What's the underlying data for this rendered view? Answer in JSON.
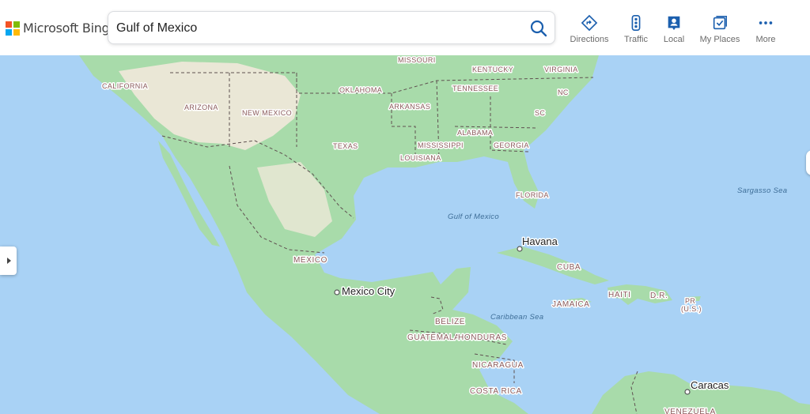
{
  "brand": {
    "name": "Microsoft Bing",
    "logo_colors": [
      "#f35325",
      "#81bc06",
      "#05a6f0",
      "#ffba08"
    ]
  },
  "search": {
    "value": "Gulf of Mexico",
    "icon": "search-icon"
  },
  "nav": [
    {
      "label": "Directions",
      "icon": "directions-icon"
    },
    {
      "label": "Traffic",
      "icon": "traffic-icon"
    },
    {
      "label": "Local",
      "icon": "local-icon"
    },
    {
      "label": "My Places",
      "icon": "my-places-icon"
    },
    {
      "label": "More",
      "icon": "more-icon"
    }
  ],
  "map": {
    "colors": {
      "water": "#a9d2f5",
      "land": "#a8dbaa",
      "desert": "#ede8d8",
      "border": "#5f5050"
    },
    "states": [
      "MISSOURI",
      "KENTUCKY",
      "VIRGINIA",
      "CALIFORNIA",
      "OKLAHOMA",
      "TENNESSEE",
      "NC",
      "ARIZONA",
      "ARKANSAS",
      "NEW MEXICO",
      "SC",
      "ALABAMA",
      "TEXAS",
      "MISSISSIPPI",
      "GEORGIA",
      "LOUISIANA",
      "FLORIDA"
    ],
    "countries": [
      "MEXICO",
      "CUBA",
      "JAMAICA",
      "HAITI",
      "D.R.",
      "PR",
      "(U.S.)",
      "BELIZE",
      "GUATEMALA",
      "HONDURAS",
      "NICARAGUA",
      "COSTA RICA",
      "VENEZUELA"
    ],
    "water": [
      "Sargasso Sea",
      "Gulf of Mexico",
      "Caribbean Sea"
    ],
    "cities": [
      "Havana",
      "Mexico City",
      "Caracas"
    ]
  }
}
